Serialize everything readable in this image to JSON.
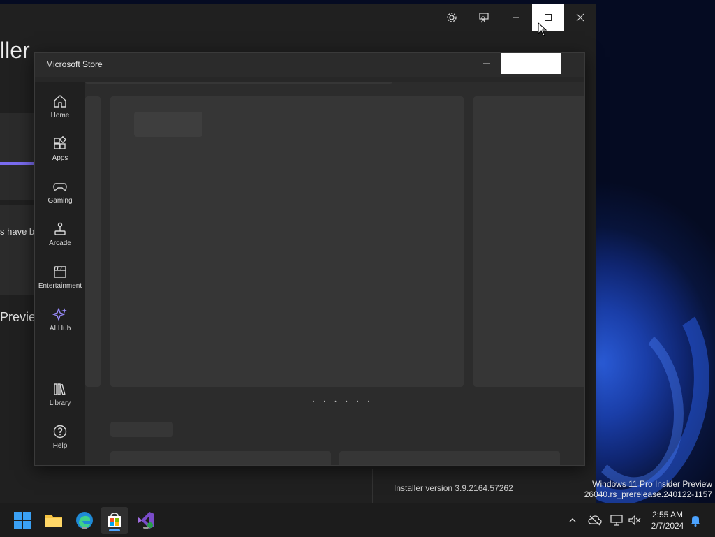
{
  "installer": {
    "heading": "ller",
    "message_fragment": "s have bee",
    "preview_fragment": "Previe",
    "version": "Installer version 3.9.2164.57262"
  },
  "watermark": {
    "line1": "Windows 11 Pro Insider Preview",
    "line2": "26040.rs_prerelease.240122-1157"
  },
  "store": {
    "title": "Microsoft Store",
    "nav": [
      {
        "label": "Home",
        "icon": "home-icon"
      },
      {
        "label": "Apps",
        "icon": "apps-icon"
      },
      {
        "label": "Gaming",
        "icon": "gamepad-icon"
      },
      {
        "label": "Arcade",
        "icon": "joystick-icon"
      },
      {
        "label": "Entertainment",
        "icon": "clapperboard-icon"
      },
      {
        "label": "AI Hub",
        "icon": "sparkle-icon"
      },
      {
        "label": "Library",
        "icon": "library-icon"
      },
      {
        "label": "Help",
        "icon": "help-icon"
      }
    ],
    "carousel_dots": "• • • • • •",
    "accent_color": "#8b7cf6"
  },
  "taskbar": {
    "apps": [
      "start-icon",
      "file-explorer-icon",
      "edge-icon",
      "store-icon",
      "visual-studio-icon"
    ],
    "time": "2:55 AM",
    "date": "2/7/2024"
  }
}
